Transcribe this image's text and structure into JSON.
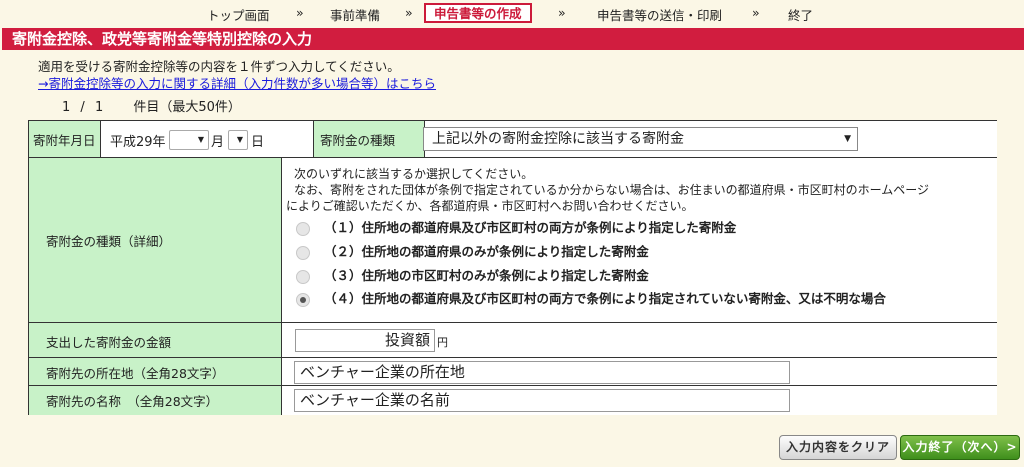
{
  "nav": {
    "steps": [
      "トップ画面",
      "事前準備",
      "申告書等の作成",
      "申告書等の送信・印刷",
      "終了"
    ],
    "separator": "»"
  },
  "section_title": "寄附金控除、政党等寄附金等特別控除の入力",
  "intro_text": "適用を受ける寄附金控除等の内容を１件ずつ入力してください。",
  "detail_link": "→寄附金控除等の入力に関する詳細（入力件数が多い場合等）はこちら",
  "counter": {
    "current": "1",
    "slash": "/",
    "total": "1",
    "suffix": "件目（最大50件）"
  },
  "form": {
    "date_label": "寄附年月日",
    "era_year": "平成29年",
    "month_unit": "月",
    "day_unit": "日",
    "type_label": "寄附金の種類",
    "type_value": "上記以外の寄附金控除に該当する寄附金",
    "detail_label": "寄附金の種類（詳細）",
    "detail_instruction_1": "次のいずれに該当するか選択してください。",
    "detail_instruction_2": "なお、寄附をされた団体が条例で指定されているか分からない場合は、お住まいの都道府県・市区町村のホームページ",
    "detail_instruction_3": "によりご確認いただくか、各都道府県・市区町村へお問い合わせください。",
    "options": [
      {
        "label": "（１）住所地の都道府県及び市区町村の両方が条例により指定した寄附金",
        "checked": false
      },
      {
        "label": "（２）住所地の都道府県のみが条例により指定した寄附金",
        "checked": false
      },
      {
        "label": "（３）住所地の市区町村のみが条例により指定した寄附金",
        "checked": false
      },
      {
        "label": "（４）住所地の都道府県及び市区町村の両方で条例により指定されていない寄附金、又は不明な場合",
        "checked": true
      }
    ],
    "amount_label": "支出した寄附金の金額",
    "amount_value": "投資額",
    "amount_unit": "円",
    "address_label": "寄附先の所在地（全角28文字）",
    "address_value": "ベンチャー企業の所在地",
    "name_label": "寄附先の名称　（全角28文字）",
    "name_value": "ベンチャー企業の名前"
  },
  "buttons": {
    "clear": "入力内容をクリア",
    "next": "入力終了（次へ）>"
  },
  "colors": {
    "accent": "#d11d3f",
    "label_bg": "#c8f2c8",
    "page_bg": "#fbf7e6",
    "next_btn": "#3f8f1c"
  }
}
